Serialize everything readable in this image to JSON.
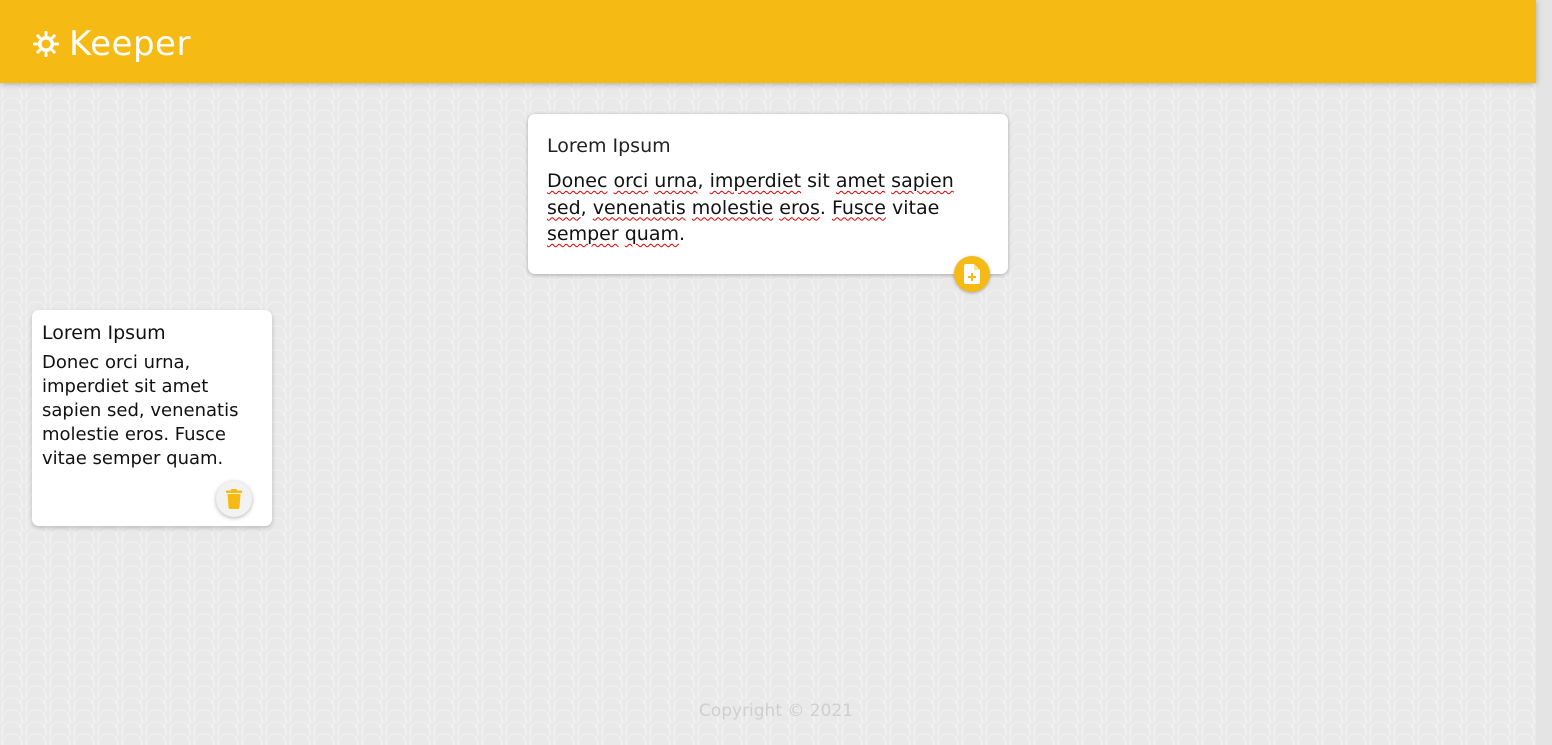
{
  "header": {
    "app_title": "Keeper",
    "logo_icon": "lightbulb-icon",
    "background_color": "#f5ba13"
  },
  "create_area": {
    "title_value": "Lorem Ipsum",
    "content_words": {
      "w1": "Donec",
      "w2": "orci",
      "w3": "urna",
      "w4": "imperdiet",
      "w5": "sit",
      "w6": "amet",
      "w7": "sapien",
      "w8": "sed",
      "w9": "venenatis",
      "w10": "molestie",
      "w11": "eros",
      "w12": "Fusce",
      "w13": "vitae",
      "w14": "semper",
      "w15": "quam"
    },
    "add_icon": "add-note-icon"
  },
  "notes": [
    {
      "title": "Lorem Ipsum",
      "content": "Donec orci urna, imperdiet sit amet sapien sed, venenatis molestie eros. Fusce vitae semper quam.",
      "delete_icon": "trash-icon"
    }
  ],
  "footer": {
    "copyright": "Copyright © 2021"
  },
  "colors": {
    "accent": "#f5ba13",
    "spellcheck": "#e00000",
    "footer_text": "#cfcfcf"
  }
}
